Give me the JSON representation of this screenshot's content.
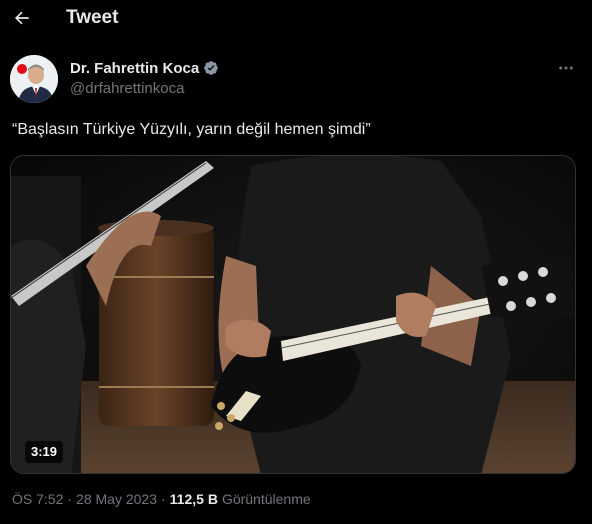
{
  "header": {
    "title": "Tweet",
    "back_icon": "arrow-left-icon"
  },
  "author": {
    "name": "Dr. Fahrettin Koca",
    "handle": "@drfahrettinkoca",
    "verified_icon": "verified-badge-icon",
    "verified_color": "#1d9bf0",
    "more_icon": "more-horizontal-icon"
  },
  "tweet": {
    "text": "“Başlasın Türkiye Yüzyılı, yarın değil hemen şimdi”"
  },
  "media": {
    "type": "video",
    "duration": "3:19"
  },
  "meta": {
    "time": "ÖS 7:52",
    "separator": "·",
    "date": "28 May 2023",
    "views_count": "112,5 B",
    "views_label": "Görüntülenme"
  },
  "colors": {
    "background": "#000000",
    "text_primary": "#e7e9ea",
    "text_secondary": "#71767b",
    "accent": "#1d9bf0",
    "border": "#2f3336"
  }
}
